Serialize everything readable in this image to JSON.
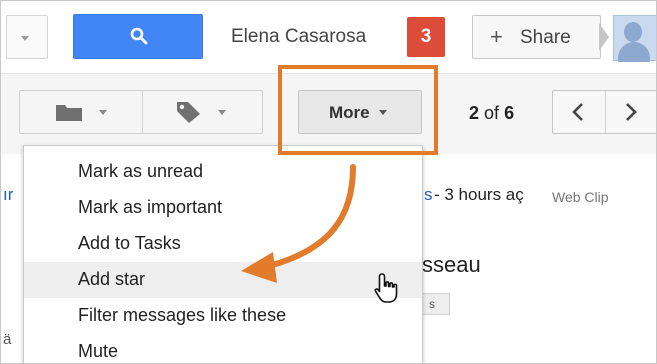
{
  "header": {
    "user_name": "Elena Casarosa",
    "notifications_count": "3",
    "share_label": "Share",
    "share_plus": "+"
  },
  "toolbar": {
    "more_label": "More",
    "pager": {
      "current": "2",
      "of": "of",
      "total": "6"
    }
  },
  "background": {
    "edge_link_fragment": "ır",
    "time_link_fragment": "s",
    "time_text": "- 3 hours aç",
    "web_clip": "Web Clip",
    "subject_fragment": "sseau",
    "chip_fragment": "s",
    "edge_fragment": "ä"
  },
  "menu": {
    "items": [
      {
        "label": "Mark as unread"
      },
      {
        "label": "Mark as important"
      },
      {
        "label": "Add to Tasks"
      },
      {
        "label": "Add star"
      },
      {
        "label": "Filter messages like these"
      },
      {
        "label": "Mute"
      }
    ],
    "active_index": 3
  },
  "icons": {
    "search": "search-icon",
    "folder": "folder-icon",
    "label": "label-tag-icon",
    "prev": "chevron-left-icon",
    "next": "chevron-right-icon",
    "cursor": "hand-pointer-icon"
  },
  "colors": {
    "search_button": "#4285f4",
    "notification_badge": "#dd4b39",
    "annotation_orange": "#e37b2c",
    "menu_hover": "#eeeeee"
  }
}
